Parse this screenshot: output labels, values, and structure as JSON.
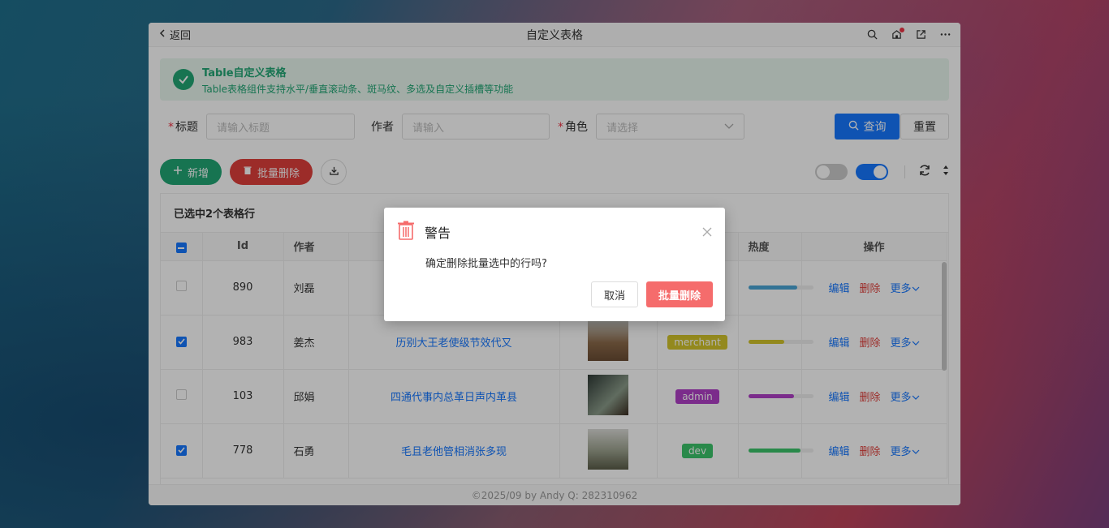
{
  "titlebar": {
    "back_label": "返回",
    "title": "自定义表格"
  },
  "alert": {
    "title": "Table自定义表格",
    "desc": "Table表格组件支持水平/垂直滚动条、斑马纹、多选及自定义插槽等功能"
  },
  "form": {
    "title_label": "标题",
    "title_placeholder": "请输入标题",
    "author_label": "作者",
    "author_placeholder": "请输入",
    "role_label": "角色",
    "role_placeholder": "请选择",
    "query_label": "查询",
    "reset_label": "重置"
  },
  "toolbar": {
    "add_label": "新增",
    "batch_delete_label": "批量删除"
  },
  "table": {
    "selected_text": "已选中2个表格行",
    "columns": [
      "Id",
      "作者",
      "热度",
      "操作"
    ],
    "rows": [
      {
        "id": "890",
        "author": "刘磊",
        "title": "",
        "tag": "",
        "tag_color": "#4aa5d6",
        "heat": 0.75,
        "heat_color": "#4aa5d6",
        "checked": false
      },
      {
        "id": "983",
        "author": "姜杰",
        "title": "历别大王老使级节效代又",
        "tag": "merchant",
        "tag_color": "#d3c52c",
        "heat": 0.55,
        "heat_color": "#d3c52c",
        "checked": true
      },
      {
        "id": "103",
        "author": "邱娟",
        "title": "四通代事内总革日声内革县",
        "tag": "admin",
        "tag_color": "#b040c8",
        "heat": 0.7,
        "heat_color": "#b040c8",
        "checked": false
      },
      {
        "id": "778",
        "author": "石勇",
        "title": "毛且老他管相消张多现",
        "tag": "dev",
        "tag_color": "#3cc46a",
        "heat": 0.8,
        "heat_color": "#3cc46a",
        "checked": true
      }
    ],
    "op_edit": "编辑",
    "op_delete": "删除",
    "op_more": "更多"
  },
  "footer": "©2025/09 by Andy Q: 282310962",
  "dialog": {
    "title": "警告",
    "message": "确定删除批量选中的行吗?",
    "cancel_label": "取消",
    "ok_label": "批量删除"
  }
}
